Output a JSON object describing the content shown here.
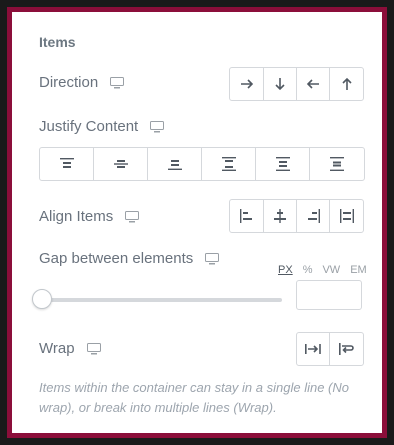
{
  "section": {
    "title": "Items"
  },
  "direction": {
    "label": "Direction",
    "responsive_icon": "monitor-icon",
    "options": [
      "arrow-right-icon",
      "arrow-down-icon",
      "arrow-left-icon",
      "arrow-up-icon"
    ]
  },
  "justify": {
    "label": "Justify Content",
    "responsive_icon": "monitor-icon",
    "options": [
      "justify-start-icon",
      "justify-center-icon",
      "justify-end-icon",
      "justify-space-between-icon",
      "justify-space-around-icon",
      "justify-space-evenly-icon"
    ]
  },
  "align": {
    "label": "Align Items",
    "responsive_icon": "monitor-icon",
    "options": [
      "align-start-icon",
      "align-center-icon",
      "align-end-icon",
      "align-stretch-icon"
    ]
  },
  "gap": {
    "label": "Gap between elements",
    "responsive_icon": "monitor-icon",
    "units": [
      "PX",
      "%",
      "VW",
      "EM"
    ],
    "active_unit": "PX",
    "slider_value": 0,
    "input_value": ""
  },
  "wrap": {
    "label": "Wrap",
    "responsive_icon": "monitor-icon",
    "options": [
      "no-wrap-icon",
      "wrap-icon"
    ]
  },
  "help_text": "Items within the container can stay in a single line (No wrap), or break into multiple lines (Wrap).",
  "colors": {
    "frame": "#8b0e3a",
    "label": "#69727d",
    "border": "#d5d8dc",
    "icon": "#515962"
  }
}
